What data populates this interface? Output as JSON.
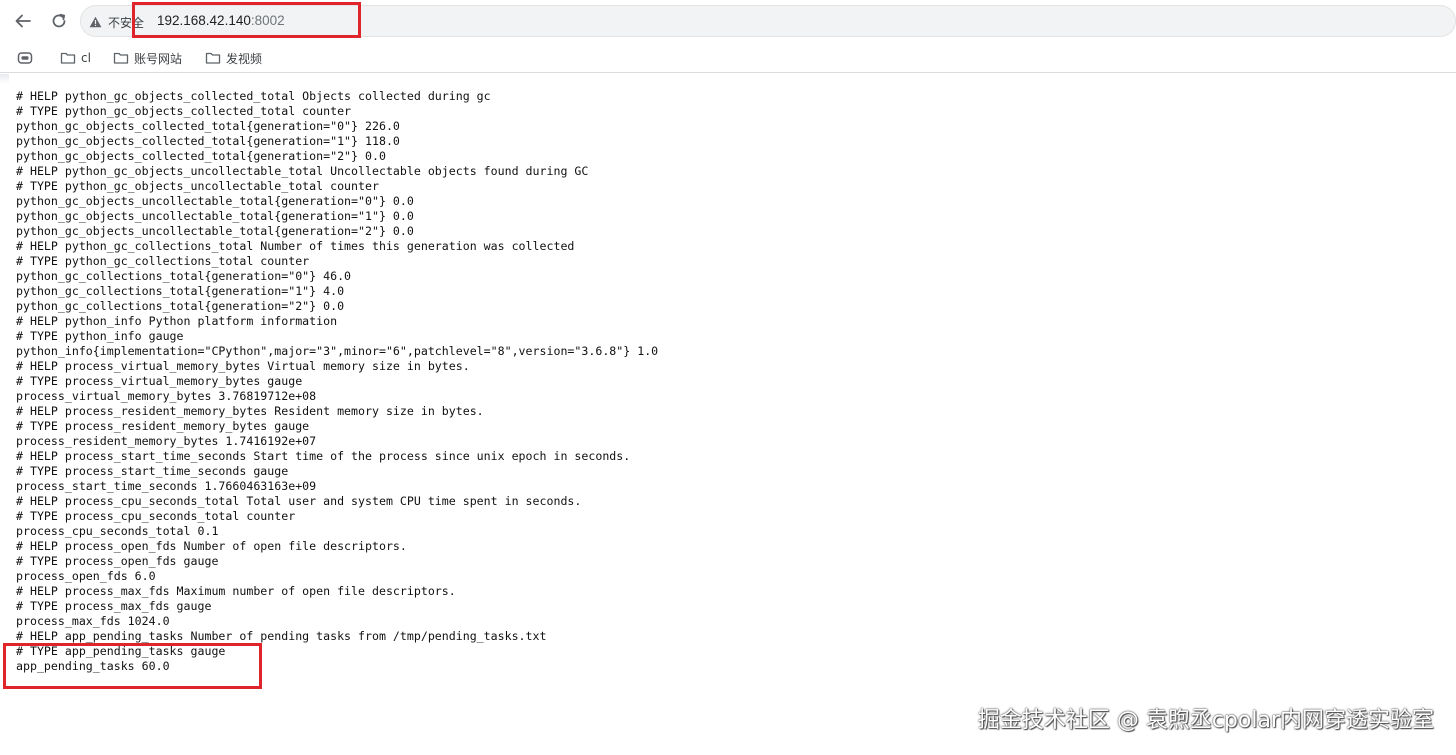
{
  "browser": {
    "security_label": "不安全",
    "url_host": "192.168.42.140",
    "url_port": ":8002"
  },
  "bookmarks": {
    "items": [
      {
        "label": "cl",
        "icon": "folder-icon"
      },
      {
        "label": "账号网站",
        "icon": "folder-icon"
      },
      {
        "label": "发视频",
        "icon": "folder-icon"
      }
    ]
  },
  "metrics": {
    "lines": [
      "# HELP python_gc_objects_collected_total Objects collected during gc",
      "# TYPE python_gc_objects_collected_total counter",
      "python_gc_objects_collected_total{generation=\"0\"} 226.0",
      "python_gc_objects_collected_total{generation=\"1\"} 118.0",
      "python_gc_objects_collected_total{generation=\"2\"} 0.0",
      "# HELP python_gc_objects_uncollectable_total Uncollectable objects found during GC",
      "# TYPE python_gc_objects_uncollectable_total counter",
      "python_gc_objects_uncollectable_total{generation=\"0\"} 0.0",
      "python_gc_objects_uncollectable_total{generation=\"1\"} 0.0",
      "python_gc_objects_uncollectable_total{generation=\"2\"} 0.0",
      "# HELP python_gc_collections_total Number of times this generation was collected",
      "# TYPE python_gc_collections_total counter",
      "python_gc_collections_total{generation=\"0\"} 46.0",
      "python_gc_collections_total{generation=\"1\"} 4.0",
      "python_gc_collections_total{generation=\"2\"} 0.0",
      "# HELP python_info Python platform information",
      "# TYPE python_info gauge",
      "python_info{implementation=\"CPython\",major=\"3\",minor=\"6\",patchlevel=\"8\",version=\"3.6.8\"} 1.0",
      "# HELP process_virtual_memory_bytes Virtual memory size in bytes.",
      "# TYPE process_virtual_memory_bytes gauge",
      "process_virtual_memory_bytes 3.76819712e+08",
      "# HELP process_resident_memory_bytes Resident memory size in bytes.",
      "# TYPE process_resident_memory_bytes gauge",
      "process_resident_memory_bytes 1.7416192e+07",
      "# HELP process_start_time_seconds Start time of the process since unix epoch in seconds.",
      "# TYPE process_start_time_seconds gauge",
      "process_start_time_seconds 1.7660463163e+09",
      "# HELP process_cpu_seconds_total Total user and system CPU time spent in seconds.",
      "# TYPE process_cpu_seconds_total counter",
      "process_cpu_seconds_total 0.1",
      "# HELP process_open_fds Number of open file descriptors.",
      "# TYPE process_open_fds gauge",
      "process_open_fds 6.0",
      "# HELP process_max_fds Maximum number of open file descriptors.",
      "# TYPE process_max_fds gauge",
      "process_max_fds 1024.0",
      "# HELP app_pending_tasks Number of pending tasks from /tmp/pending_tasks.txt",
      "# TYPE app_pending_tasks gauge",
      "app_pending_tasks 60.0"
    ]
  },
  "watermark": {
    "text": "掘金技术社区 @ 袁煦丞cpolar内网穿透实验室"
  },
  "colors": {
    "highlight": "#e0242b",
    "omnibox_bg": "#f1f3f4"
  }
}
